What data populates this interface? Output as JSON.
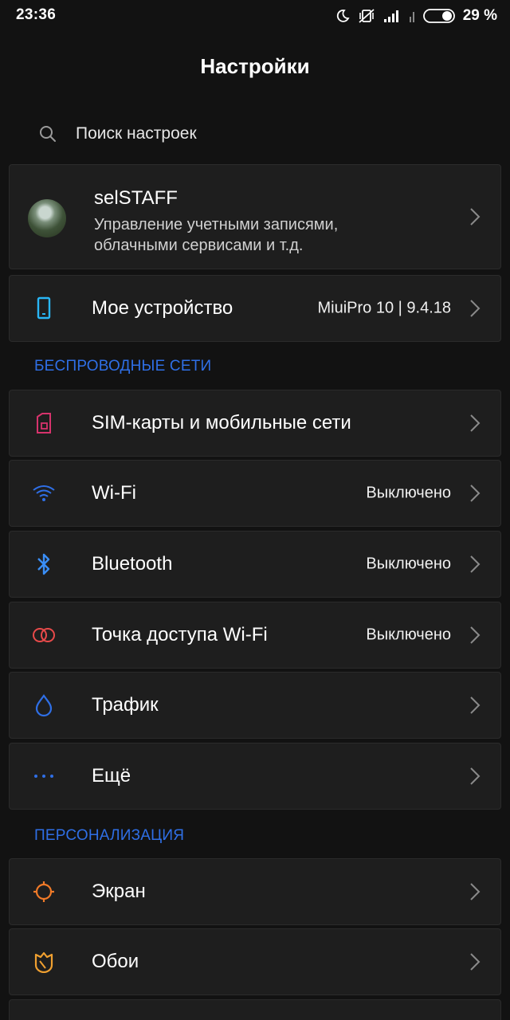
{
  "status_bar": {
    "time": "23:36",
    "battery_percent": "29 %",
    "icons": [
      "moon-icon",
      "vibrate-off-icon",
      "signal-icon",
      "signal-icon",
      "battery-icon"
    ]
  },
  "title": "Настройки",
  "search": {
    "placeholder": "Поиск настроек"
  },
  "account": {
    "name": "selSTAFF",
    "description_line1": "Управление учетными записями,",
    "description_line2": "облачными сервисами и т.д."
  },
  "device": {
    "label": "Мое устройство",
    "value": "MiuiPro 10 | 9.4.18"
  },
  "sections": {
    "wireless": {
      "header": "БЕСПРОВОДНЫЕ СЕТИ",
      "items": [
        {
          "label": "SIM-карты и мобильные сети",
          "value": "",
          "icon": "sim-card-icon"
        },
        {
          "label": "Wi-Fi",
          "value": "Выключено",
          "icon": "wifi-icon"
        },
        {
          "label": "Bluetooth",
          "value": "Выключено",
          "icon": "bluetooth-icon"
        },
        {
          "label": "Точка доступа Wi-Fi",
          "value": "Выключено",
          "icon": "hotspot-icon"
        },
        {
          "label": "Трафик",
          "value": "",
          "icon": "traffic-drop-icon"
        },
        {
          "label": "Ещё",
          "value": "",
          "icon": "more-dots-icon"
        }
      ]
    },
    "personalization": {
      "header": "ПЕРСОНАЛИЗАЦИЯ",
      "items": [
        {
          "label": "Экран",
          "value": "",
          "icon": "display-sun-icon"
        },
        {
          "label": "Обои",
          "value": "",
          "icon": "wallpaper-icon"
        }
      ]
    }
  },
  "colors": {
    "background": "#121212",
    "card": "#1e1e1e",
    "section_header": "#2f6fe6",
    "device_icon": "#29b6f6",
    "sim_icon": "#d6336c",
    "wifi_icon": "#2f6fe6",
    "bluetooth_icon": "#3a8ef6",
    "hotspot_icon": "#e84a4a",
    "traffic_icon": "#2f6fe6",
    "more_icon": "#2f6fe6",
    "display_icon": "#f07a28",
    "wallpaper_icon": "#f0a030"
  }
}
